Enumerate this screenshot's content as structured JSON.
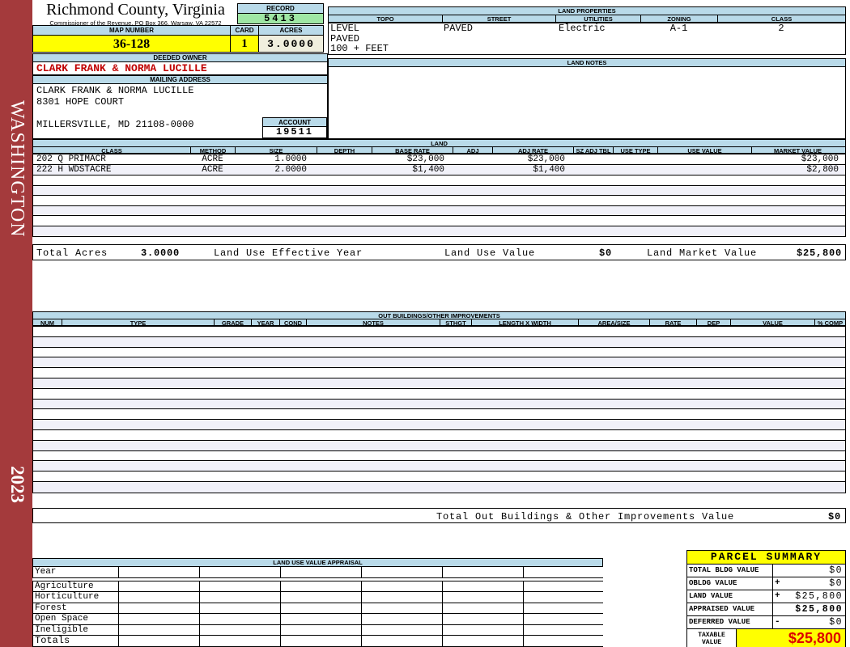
{
  "sidebar": {
    "district": "WASHINGTON",
    "year": "2023"
  },
  "header": {
    "county_title": "Richmond County, Virginia",
    "county_subtitle": "Commissioner of the Revenue, PO Box 366, Warsaw, VA 22572",
    "record_label": "RECORD",
    "record_value": "5413",
    "map_number_label": "MAP NUMBER",
    "map_number_value": "36-128",
    "card_label": "CARD",
    "card_value": "1",
    "acres_label": "ACRES",
    "acres_value": "3.0000"
  },
  "land_properties": {
    "title": "LAND PROPERTIES",
    "columns": [
      "TOPO",
      "STREET",
      "UTILITIES",
      "ZONING",
      "CLASS"
    ],
    "topo_lines": [
      "LEVEL",
      "PAVED",
      "100 + FEET"
    ],
    "street": "PAVED",
    "utilities": "Electric",
    "zoning": "A-1",
    "class": "2"
  },
  "owner": {
    "deeded_owner_label": "DEEDED OWNER",
    "deeded_owner": "CLARK FRANK & NORMA LUCILLE",
    "mailing_address_label": "MAILING ADDRESS",
    "address_line1": "CLARK FRANK & NORMA LUCILLE",
    "address_line2": "8301 HOPE COURT",
    "address_line3": "MILLERSVILLE, MD 21108-0000",
    "account_label": "ACCOUNT",
    "account_value": "19511"
  },
  "land_notes": {
    "title": "LAND NOTES"
  },
  "land": {
    "title": "LAND",
    "columns": [
      "CLASS",
      "METHOD",
      "SIZE",
      "DEPTH",
      "BASE RATE",
      "ADJ",
      "ADJ RATE",
      "SZ ADJ TBL",
      "USE TYPE",
      "USE VALUE",
      "MARKET VALUE"
    ],
    "rows": [
      {
        "class": "202 Q PRIMACR",
        "method": "ACRE",
        "size": "1.0000",
        "base_rate": "$23,000",
        "adj_rate": "$23,000",
        "market_value": "$23,000"
      },
      {
        "class": "222 H WDSTACRE",
        "method": "ACRE",
        "size": "2.0000",
        "base_rate": "$1,400",
        "adj_rate": "$1,400",
        "market_value": "$2,800"
      }
    ],
    "totals": {
      "total_acres_label": "Total Acres",
      "total_acres": "3.0000",
      "effective_year_label": "Land Use Effective Year",
      "use_value_label": "Land Use Value",
      "use_value": "$0",
      "market_value_label": "Land Market Value",
      "market_value": "$25,800"
    }
  },
  "out_buildings": {
    "title": "OUT BUILDINGS/OTHER IMPROVEMENTS",
    "columns": [
      "NUM",
      "TYPE",
      "GRADE",
      "YEAR",
      "COND",
      "NOTES",
      "STHGT",
      "LENGTH X WIDTH",
      "AREA/SIZE",
      "RATE",
      "DEP",
      "VALUE",
      "% COMP"
    ],
    "total_label": "Total Out Buildings & Other Improvements Value",
    "total_value": "$0"
  },
  "land_use_appraisal": {
    "title": "LAND USE VALUE APPRAISAL",
    "row_labels": [
      "Year",
      "Agriculture",
      "Horticulture",
      "Forest",
      "Open Space",
      "Ineligible",
      "Totals"
    ]
  },
  "parcel_summary": {
    "title": "PARCEL SUMMARY",
    "rows": [
      {
        "label": "TOTAL BLDG VALUE",
        "op": "",
        "value": "$0"
      },
      {
        "label": "OBLDG VALUE",
        "op": "+",
        "value": "$0"
      },
      {
        "label": "LAND VALUE",
        "op": "+",
        "value": "$25,800"
      },
      {
        "label": "APPRAISED VALUE",
        "op": "",
        "value": "$25,800"
      },
      {
        "label": "DEFERRED VALUE",
        "op": "-",
        "value": "$0"
      }
    ],
    "taxable_label_line1": "TAXABLE",
    "taxable_label_line2": "VALUE",
    "taxable_value": "$25,800"
  },
  "colors": {
    "header_blue": "#B9DAE9",
    "record_green": "#9FE7A4",
    "highlight_yellow": "#FFFF00",
    "cream": "#F0EFDE",
    "sidebar_red": "#A43A3C",
    "owner_red": "#C00000",
    "taxable_red": "#DD0000",
    "row_alt": "#F1F1F9"
  }
}
